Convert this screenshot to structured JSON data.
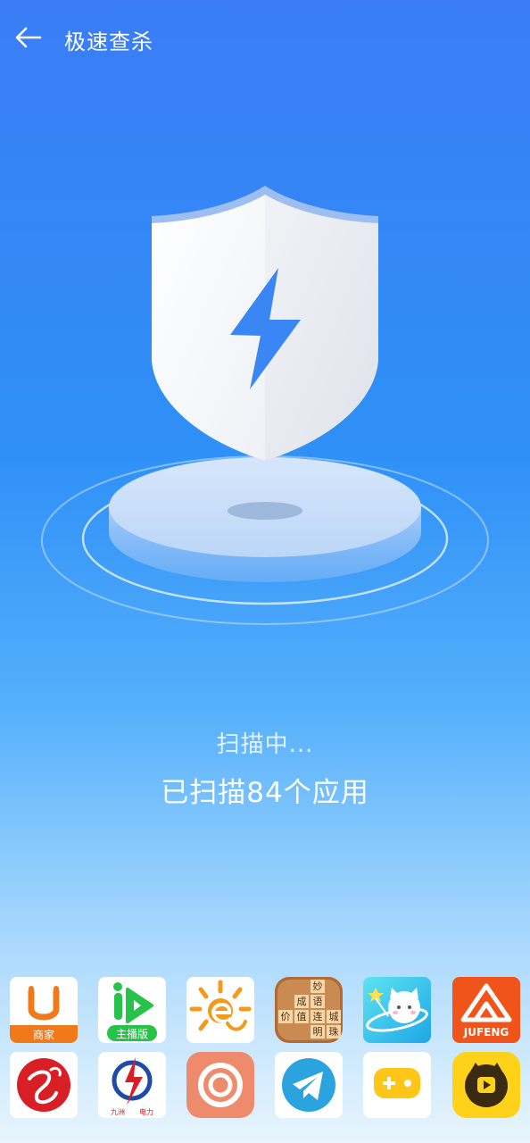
{
  "header": {
    "title": "极速查杀"
  },
  "scan": {
    "status": "扫描中...",
    "count_text": "已扫描84个应用"
  },
  "apps": [
    {
      "name": "u-merchant-app-icon",
      "label": "商家"
    },
    {
      "name": "live-streamer-app-icon",
      "label": "主播版"
    },
    {
      "name": "sun-e-app-icon"
    },
    {
      "name": "idiom-game-app-icon",
      "tiles": [
        "妙",
        "成",
        "语",
        "价",
        "值",
        "连",
        "城",
        "明",
        "珠"
      ]
    },
    {
      "name": "cat-planet-app-icon"
    },
    {
      "name": "jufeng-app-icon",
      "label": "JUFENG"
    },
    {
      "name": "red-calligraphy-app-icon"
    },
    {
      "name": "electric-power-app-icon",
      "label_left": "九洲",
      "label_right": "电力"
    },
    {
      "name": "orange-ring-app-icon"
    },
    {
      "name": "telegram-app-icon"
    },
    {
      "name": "game-controller-app-icon"
    },
    {
      "name": "tiger-video-app-icon"
    }
  ],
  "colors": {
    "brand_blue": "#3a7df5",
    "shield_bolt": "#3a86f4"
  }
}
